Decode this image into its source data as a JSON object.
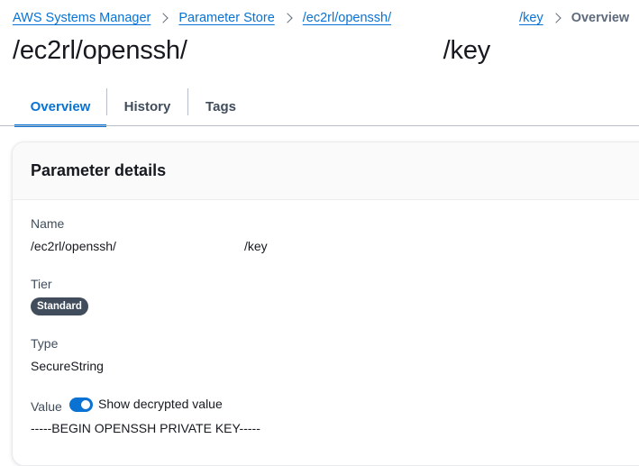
{
  "breadcrumb": {
    "items": [
      "AWS Systems Manager",
      "Parameter Store"
    ],
    "param_prefix": "/ec2rl/openssh/",
    "param_suffix": "/key",
    "current": "Overview"
  },
  "page": {
    "title_prefix": "/ec2rl/openssh/",
    "title_suffix": "/key"
  },
  "tabs": [
    {
      "label": "Overview",
      "active": true
    },
    {
      "label": "History",
      "active": false
    },
    {
      "label": "Tags",
      "active": false
    }
  ],
  "details": {
    "heading": "Parameter details",
    "name_label": "Name",
    "name_prefix": "/ec2rl/openssh/",
    "name_suffix": "/key",
    "tier_label": "Tier",
    "tier_value": "Standard",
    "type_label": "Type",
    "type_value": "SecureString",
    "value_label": "Value",
    "toggle_label": "Show decrypted value",
    "toggle_on": true,
    "value_text": "-----BEGIN OPENSSH PRIVATE KEY-----"
  },
  "colors": {
    "link": "#0972d3",
    "badge": "#414d5c",
    "toggle": "#0972d3"
  }
}
